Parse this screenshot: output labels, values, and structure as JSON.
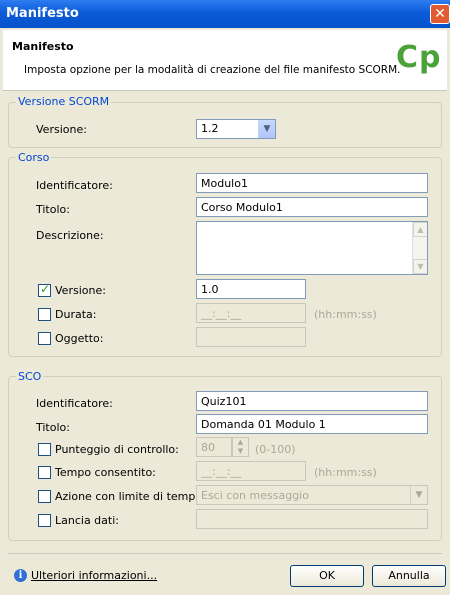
{
  "window": {
    "title": "Manifesto",
    "close_glyph": "✕"
  },
  "header": {
    "title": "Manifesto",
    "subtitle": "Imposta opzione per la modalità di creazione del file manifesto SCORM.",
    "logo": "Cp"
  },
  "scorm": {
    "legend": "Versione SCORM",
    "version_label": "Versione:",
    "version_value": "1.2"
  },
  "course": {
    "legend": "Corso",
    "identifier_label": "Identificatore:",
    "identifier_value": "Modulo1",
    "title_label": "Titolo:",
    "title_value": "Corso Modulo1",
    "description_label": "Descrizione:",
    "description_value": "",
    "version_label": "Versione:",
    "version_value": "1.0",
    "version_checked": true,
    "duration_label": "Durata:",
    "duration_value": "__:__:__",
    "duration_hint": "(hh:mm:ss)",
    "object_label": "Oggetto:",
    "object_value": ""
  },
  "sco": {
    "legend": "SCO",
    "identifier_label": "Identificatore:",
    "identifier_value": "Quiz101",
    "title_label": "Titolo:",
    "title_value": "Domanda 01 Modulo 1",
    "score_label": "Punteggio di controllo:",
    "score_value": "80",
    "score_hint": "(0-100)",
    "time_label": "Tempo consentito:",
    "time_value": "__:__:__",
    "time_hint": "(hh:mm:ss)",
    "action_label": "Azione con limite di tempo:",
    "action_value": "Esci con messaggio",
    "launch_label": "Lancia dati:",
    "launch_value": ""
  },
  "footer": {
    "more_info": "Ulteriori informazioni...",
    "ok": "OK",
    "cancel": "Annulla"
  }
}
